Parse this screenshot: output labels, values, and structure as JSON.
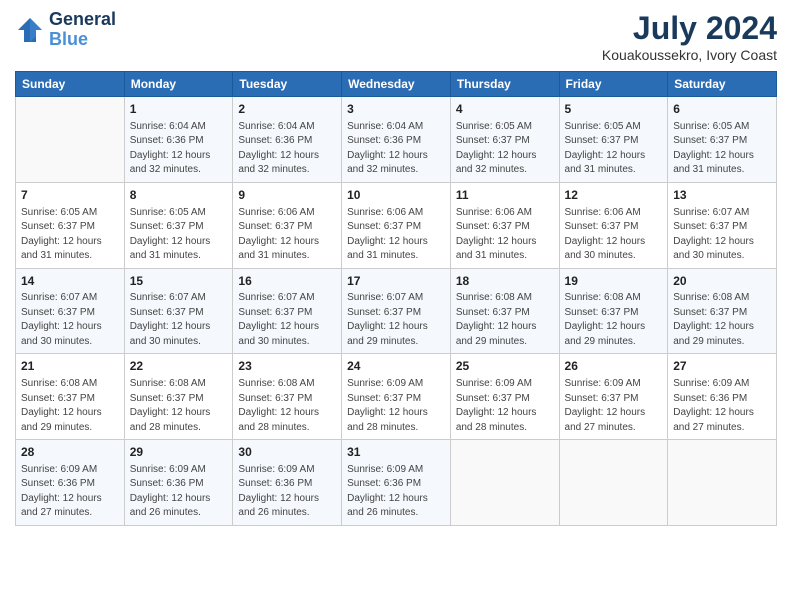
{
  "header": {
    "logo_line1": "General",
    "logo_line2": "Blue",
    "title": "July 2024",
    "subtitle": "Kouakoussekro, Ivory Coast"
  },
  "columns": [
    "Sunday",
    "Monday",
    "Tuesday",
    "Wednesday",
    "Thursday",
    "Friday",
    "Saturday"
  ],
  "weeks": [
    [
      {
        "day": "",
        "info": ""
      },
      {
        "day": "1",
        "info": "Sunrise: 6:04 AM\nSunset: 6:36 PM\nDaylight: 12 hours\nand 32 minutes."
      },
      {
        "day": "2",
        "info": "Sunrise: 6:04 AM\nSunset: 6:36 PM\nDaylight: 12 hours\nand 32 minutes."
      },
      {
        "day": "3",
        "info": "Sunrise: 6:04 AM\nSunset: 6:36 PM\nDaylight: 12 hours\nand 32 minutes."
      },
      {
        "day": "4",
        "info": "Sunrise: 6:05 AM\nSunset: 6:37 PM\nDaylight: 12 hours\nand 32 minutes."
      },
      {
        "day": "5",
        "info": "Sunrise: 6:05 AM\nSunset: 6:37 PM\nDaylight: 12 hours\nand 31 minutes."
      },
      {
        "day": "6",
        "info": "Sunrise: 6:05 AM\nSunset: 6:37 PM\nDaylight: 12 hours\nand 31 minutes."
      }
    ],
    [
      {
        "day": "7",
        "info": "Sunrise: 6:05 AM\nSunset: 6:37 PM\nDaylight: 12 hours\nand 31 minutes."
      },
      {
        "day": "8",
        "info": "Sunrise: 6:05 AM\nSunset: 6:37 PM\nDaylight: 12 hours\nand 31 minutes."
      },
      {
        "day": "9",
        "info": "Sunrise: 6:06 AM\nSunset: 6:37 PM\nDaylight: 12 hours\nand 31 minutes."
      },
      {
        "day": "10",
        "info": "Sunrise: 6:06 AM\nSunset: 6:37 PM\nDaylight: 12 hours\nand 31 minutes."
      },
      {
        "day": "11",
        "info": "Sunrise: 6:06 AM\nSunset: 6:37 PM\nDaylight: 12 hours\nand 31 minutes."
      },
      {
        "day": "12",
        "info": "Sunrise: 6:06 AM\nSunset: 6:37 PM\nDaylight: 12 hours\nand 30 minutes."
      },
      {
        "day": "13",
        "info": "Sunrise: 6:07 AM\nSunset: 6:37 PM\nDaylight: 12 hours\nand 30 minutes."
      }
    ],
    [
      {
        "day": "14",
        "info": "Sunrise: 6:07 AM\nSunset: 6:37 PM\nDaylight: 12 hours\nand 30 minutes."
      },
      {
        "day": "15",
        "info": "Sunrise: 6:07 AM\nSunset: 6:37 PM\nDaylight: 12 hours\nand 30 minutes."
      },
      {
        "day": "16",
        "info": "Sunrise: 6:07 AM\nSunset: 6:37 PM\nDaylight: 12 hours\nand 30 minutes."
      },
      {
        "day": "17",
        "info": "Sunrise: 6:07 AM\nSunset: 6:37 PM\nDaylight: 12 hours\nand 29 minutes."
      },
      {
        "day": "18",
        "info": "Sunrise: 6:08 AM\nSunset: 6:37 PM\nDaylight: 12 hours\nand 29 minutes."
      },
      {
        "day": "19",
        "info": "Sunrise: 6:08 AM\nSunset: 6:37 PM\nDaylight: 12 hours\nand 29 minutes."
      },
      {
        "day": "20",
        "info": "Sunrise: 6:08 AM\nSunset: 6:37 PM\nDaylight: 12 hours\nand 29 minutes."
      }
    ],
    [
      {
        "day": "21",
        "info": "Sunrise: 6:08 AM\nSunset: 6:37 PM\nDaylight: 12 hours\nand 29 minutes."
      },
      {
        "day": "22",
        "info": "Sunrise: 6:08 AM\nSunset: 6:37 PM\nDaylight: 12 hours\nand 28 minutes."
      },
      {
        "day": "23",
        "info": "Sunrise: 6:08 AM\nSunset: 6:37 PM\nDaylight: 12 hours\nand 28 minutes."
      },
      {
        "day": "24",
        "info": "Sunrise: 6:09 AM\nSunset: 6:37 PM\nDaylight: 12 hours\nand 28 minutes."
      },
      {
        "day": "25",
        "info": "Sunrise: 6:09 AM\nSunset: 6:37 PM\nDaylight: 12 hours\nand 28 minutes."
      },
      {
        "day": "26",
        "info": "Sunrise: 6:09 AM\nSunset: 6:37 PM\nDaylight: 12 hours\nand 27 minutes."
      },
      {
        "day": "27",
        "info": "Sunrise: 6:09 AM\nSunset: 6:36 PM\nDaylight: 12 hours\nand 27 minutes."
      }
    ],
    [
      {
        "day": "28",
        "info": "Sunrise: 6:09 AM\nSunset: 6:36 PM\nDaylight: 12 hours\nand 27 minutes."
      },
      {
        "day": "29",
        "info": "Sunrise: 6:09 AM\nSunset: 6:36 PM\nDaylight: 12 hours\nand 26 minutes."
      },
      {
        "day": "30",
        "info": "Sunrise: 6:09 AM\nSunset: 6:36 PM\nDaylight: 12 hours\nand 26 minutes."
      },
      {
        "day": "31",
        "info": "Sunrise: 6:09 AM\nSunset: 6:36 PM\nDaylight: 12 hours\nand 26 minutes."
      },
      {
        "day": "",
        "info": ""
      },
      {
        "day": "",
        "info": ""
      },
      {
        "day": "",
        "info": ""
      }
    ]
  ]
}
